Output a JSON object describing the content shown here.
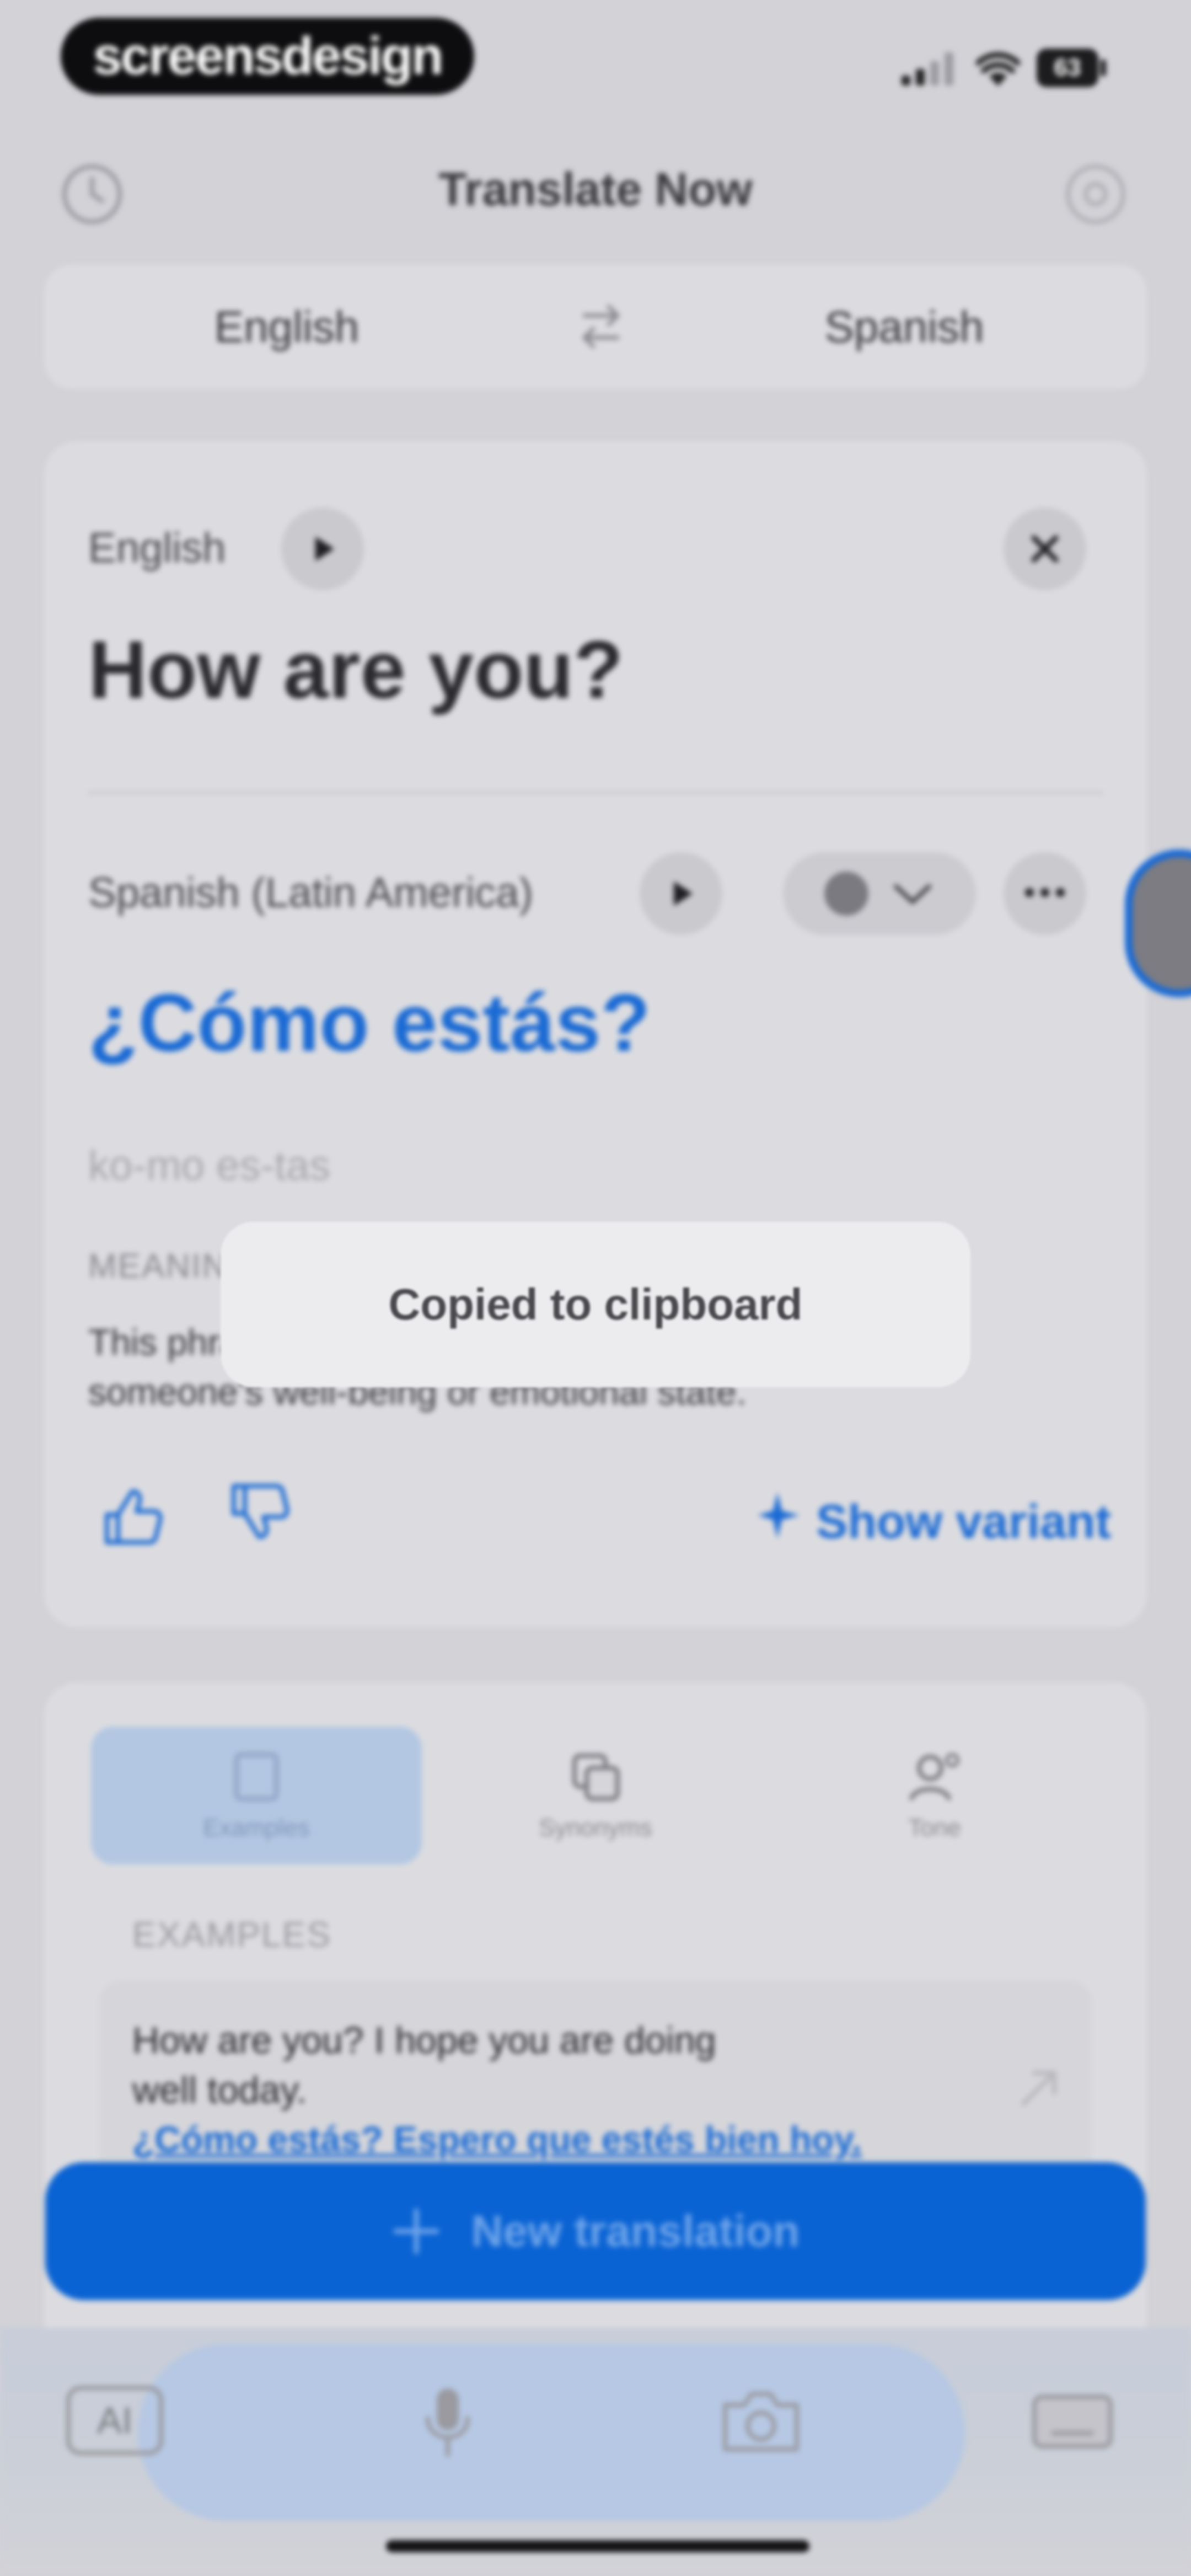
{
  "status_bar": {
    "brand": "screensdesign",
    "battery": "63"
  },
  "header": {
    "title": "Translate Now"
  },
  "language_bar": {
    "source": "English",
    "target": "Spanish"
  },
  "source": {
    "language": "English",
    "text": "How are you?"
  },
  "translation": {
    "language": "Spanish (Latin America)",
    "text": "¿Cómo estás?",
    "pronunciation": "ko-mo es-tas",
    "meaning_heading": "MEANING",
    "meaning_line1": "This phrase is used to ask about",
    "meaning_line2": "someone's well-being or emotional state.",
    "show_variant": "Show variant"
  },
  "toast": {
    "text": "Copied to clipboard"
  },
  "tabs": [
    {
      "label": "Examples"
    },
    {
      "label": "Synonyms"
    },
    {
      "label": "Tone"
    }
  ],
  "examples": {
    "heading": "EXAMPLES",
    "items": [
      {
        "source_line1": "How are you? I hope you are doing",
        "source_line2": "well today.",
        "translation": "¿Cómo estás? Espero que estés bien hoy."
      }
    ]
  },
  "new_translation": {
    "label": "New translation"
  },
  "toolbar": {
    "ai_label": "AI"
  },
  "colors": {
    "accent": "#1a6ad4",
    "primary_button": "#0a63d3",
    "background": "#d2d2d7",
    "card": "#dcdce0"
  }
}
